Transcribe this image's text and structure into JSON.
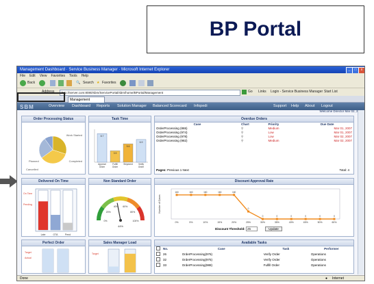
{
  "slide": {
    "title": "BP Portal"
  },
  "browser": {
    "window_title": "Management Dashboard · Service Business Manager · Microsoft Internet Explorer",
    "menu": [
      "File",
      "Edit",
      "View",
      "Favorites",
      "Tools",
      "Help"
    ],
    "toolbar": {
      "back_label": "Back",
      "search_label": "Search",
      "favorites_label": "Favorites"
    },
    "address_label": "Address",
    "address_value": "http://server.com:8080/sbm/ServicePortal/sbm/home/BPortal/Management",
    "go_label": "Go",
    "links_label": "Links",
    "extra_links": [
      "Login - Service Business Manager",
      "Start List"
    ],
    "tab_label": "Management",
    "status_text": "Done",
    "zone_text": "Internet"
  },
  "app": {
    "logo": "SBM",
    "nav": [
      "Overview",
      "Dashboard",
      "Reports",
      "Solution Manager",
      "Balanced Scorecard",
      "Infopedi"
    ],
    "links": [
      "Support",
      "Help",
      "About",
      "Logout"
    ],
    "welcome": "Welcome Director Mar 02, 2007"
  },
  "panels": {
    "order_processing_status": {
      "title": "Order Processing Status",
      "labels": [
        "Work Started",
        "Completed",
        "Planned",
        "Cancelled"
      ],
      "values": [
        30,
        35,
        25,
        10
      ],
      "colors": [
        "#d9b429",
        "#f4c94a",
        "#a4b8d8",
        "#8aa3cf"
      ]
    },
    "task_time": {
      "title": "Task Time",
      "categories": [
        "Approve Order",
        "Fulfill Order",
        "Shipment",
        "Verify Order"
      ],
      "values": [
        8.7,
        3.5,
        5.6,
        6.9
      ],
      "labels": [
        "8.7",
        "3.5",
        "5.6",
        "6.9"
      ]
    },
    "overdue_orders": {
      "title": "Overdue Orders",
      "columns": [
        "Case",
        "Chart",
        "Priority",
        "Due Date"
      ],
      "rows": [
        {
          "case": "OrderProcessing (865)",
          "priority": "Medium",
          "due": "Mar 01, 2007"
        },
        {
          "case": "OrderProcessing (974)",
          "priority": "Low",
          "due": "Mar 01, 2007"
        },
        {
          "case": "OrderProcessing (978)",
          "priority": "Low",
          "due": "Mar 02, 2007"
        },
        {
          "case": "OrderProcessing (982)",
          "priority": "Medium",
          "due": "Mar 02, 2007"
        }
      ],
      "pages_label": "Pages:",
      "pages_value": "Previous  1  Next",
      "total_label": "Total: 4"
    },
    "delivered_on_time": {
      "title": "Delivered On Time",
      "bars": [
        {
          "label": "Late",
          "value": 72,
          "color": "#e0362b"
        },
        {
          "label": "On Time",
          "value": 38,
          "color": "#8fa8d4"
        },
        {
          "label": "Pending",
          "value": 18,
          "color": "#c9c9c9"
        }
      ],
      "axis_labels": [
        "Late",
        "OTA",
        "Pend"
      ]
    },
    "non_standard_order": {
      "title": "Non Standard Order",
      "tick_labels": [
        "0%",
        "20%",
        "40%",
        "60%",
        "80%",
        "100%"
      ],
      "value_label": "44%",
      "value": 44
    },
    "discount_approval_rate": {
      "title": "Discount Approval Rate",
      "ylabel": "Number of Cases",
      "x": [
        "0%",
        "5%",
        "10%",
        "15%",
        "20%",
        "25%",
        "30%",
        "35%",
        "40%",
        "45%",
        "50%",
        "60%"
      ],
      "values": [
        160,
        160,
        160,
        160,
        160,
        50,
        0,
        0,
        0,
        0,
        0,
        0
      ],
      "point_labels": [
        "160",
        "160",
        "160",
        "160",
        "160",
        "0",
        "0",
        "0",
        "0",
        "0",
        "0",
        "0"
      ],
      "threshold_label": "Discount Threshold:",
      "threshold_value": "25",
      "update_label": "Update"
    },
    "perfect_order": {
      "title": "Perfect Order",
      "labels": [
        "Target",
        "Actual"
      ],
      "values": [
        100,
        100
      ]
    },
    "sales_manager_load": {
      "title": "Sales Manager Load",
      "label": "Target",
      "values": [
        25,
        80
      ]
    },
    "available_tasks": {
      "title": "Available Tasks",
      "columns": [
        "No.",
        "Case",
        "Task",
        "Performer"
      ],
      "rows": [
        {
          "no": "26",
          "case": "OrderProcessing(976)",
          "task": "Verify Order",
          "performer": "Operations"
        },
        {
          "no": "32",
          "case": "OrderProcessing(975)",
          "task": "Verify Order",
          "performer": "Operations"
        },
        {
          "no": "33",
          "case": "OrderProcessing(988)",
          "task": "Fulfill Order",
          "performer": "Operations"
        }
      ]
    }
  }
}
